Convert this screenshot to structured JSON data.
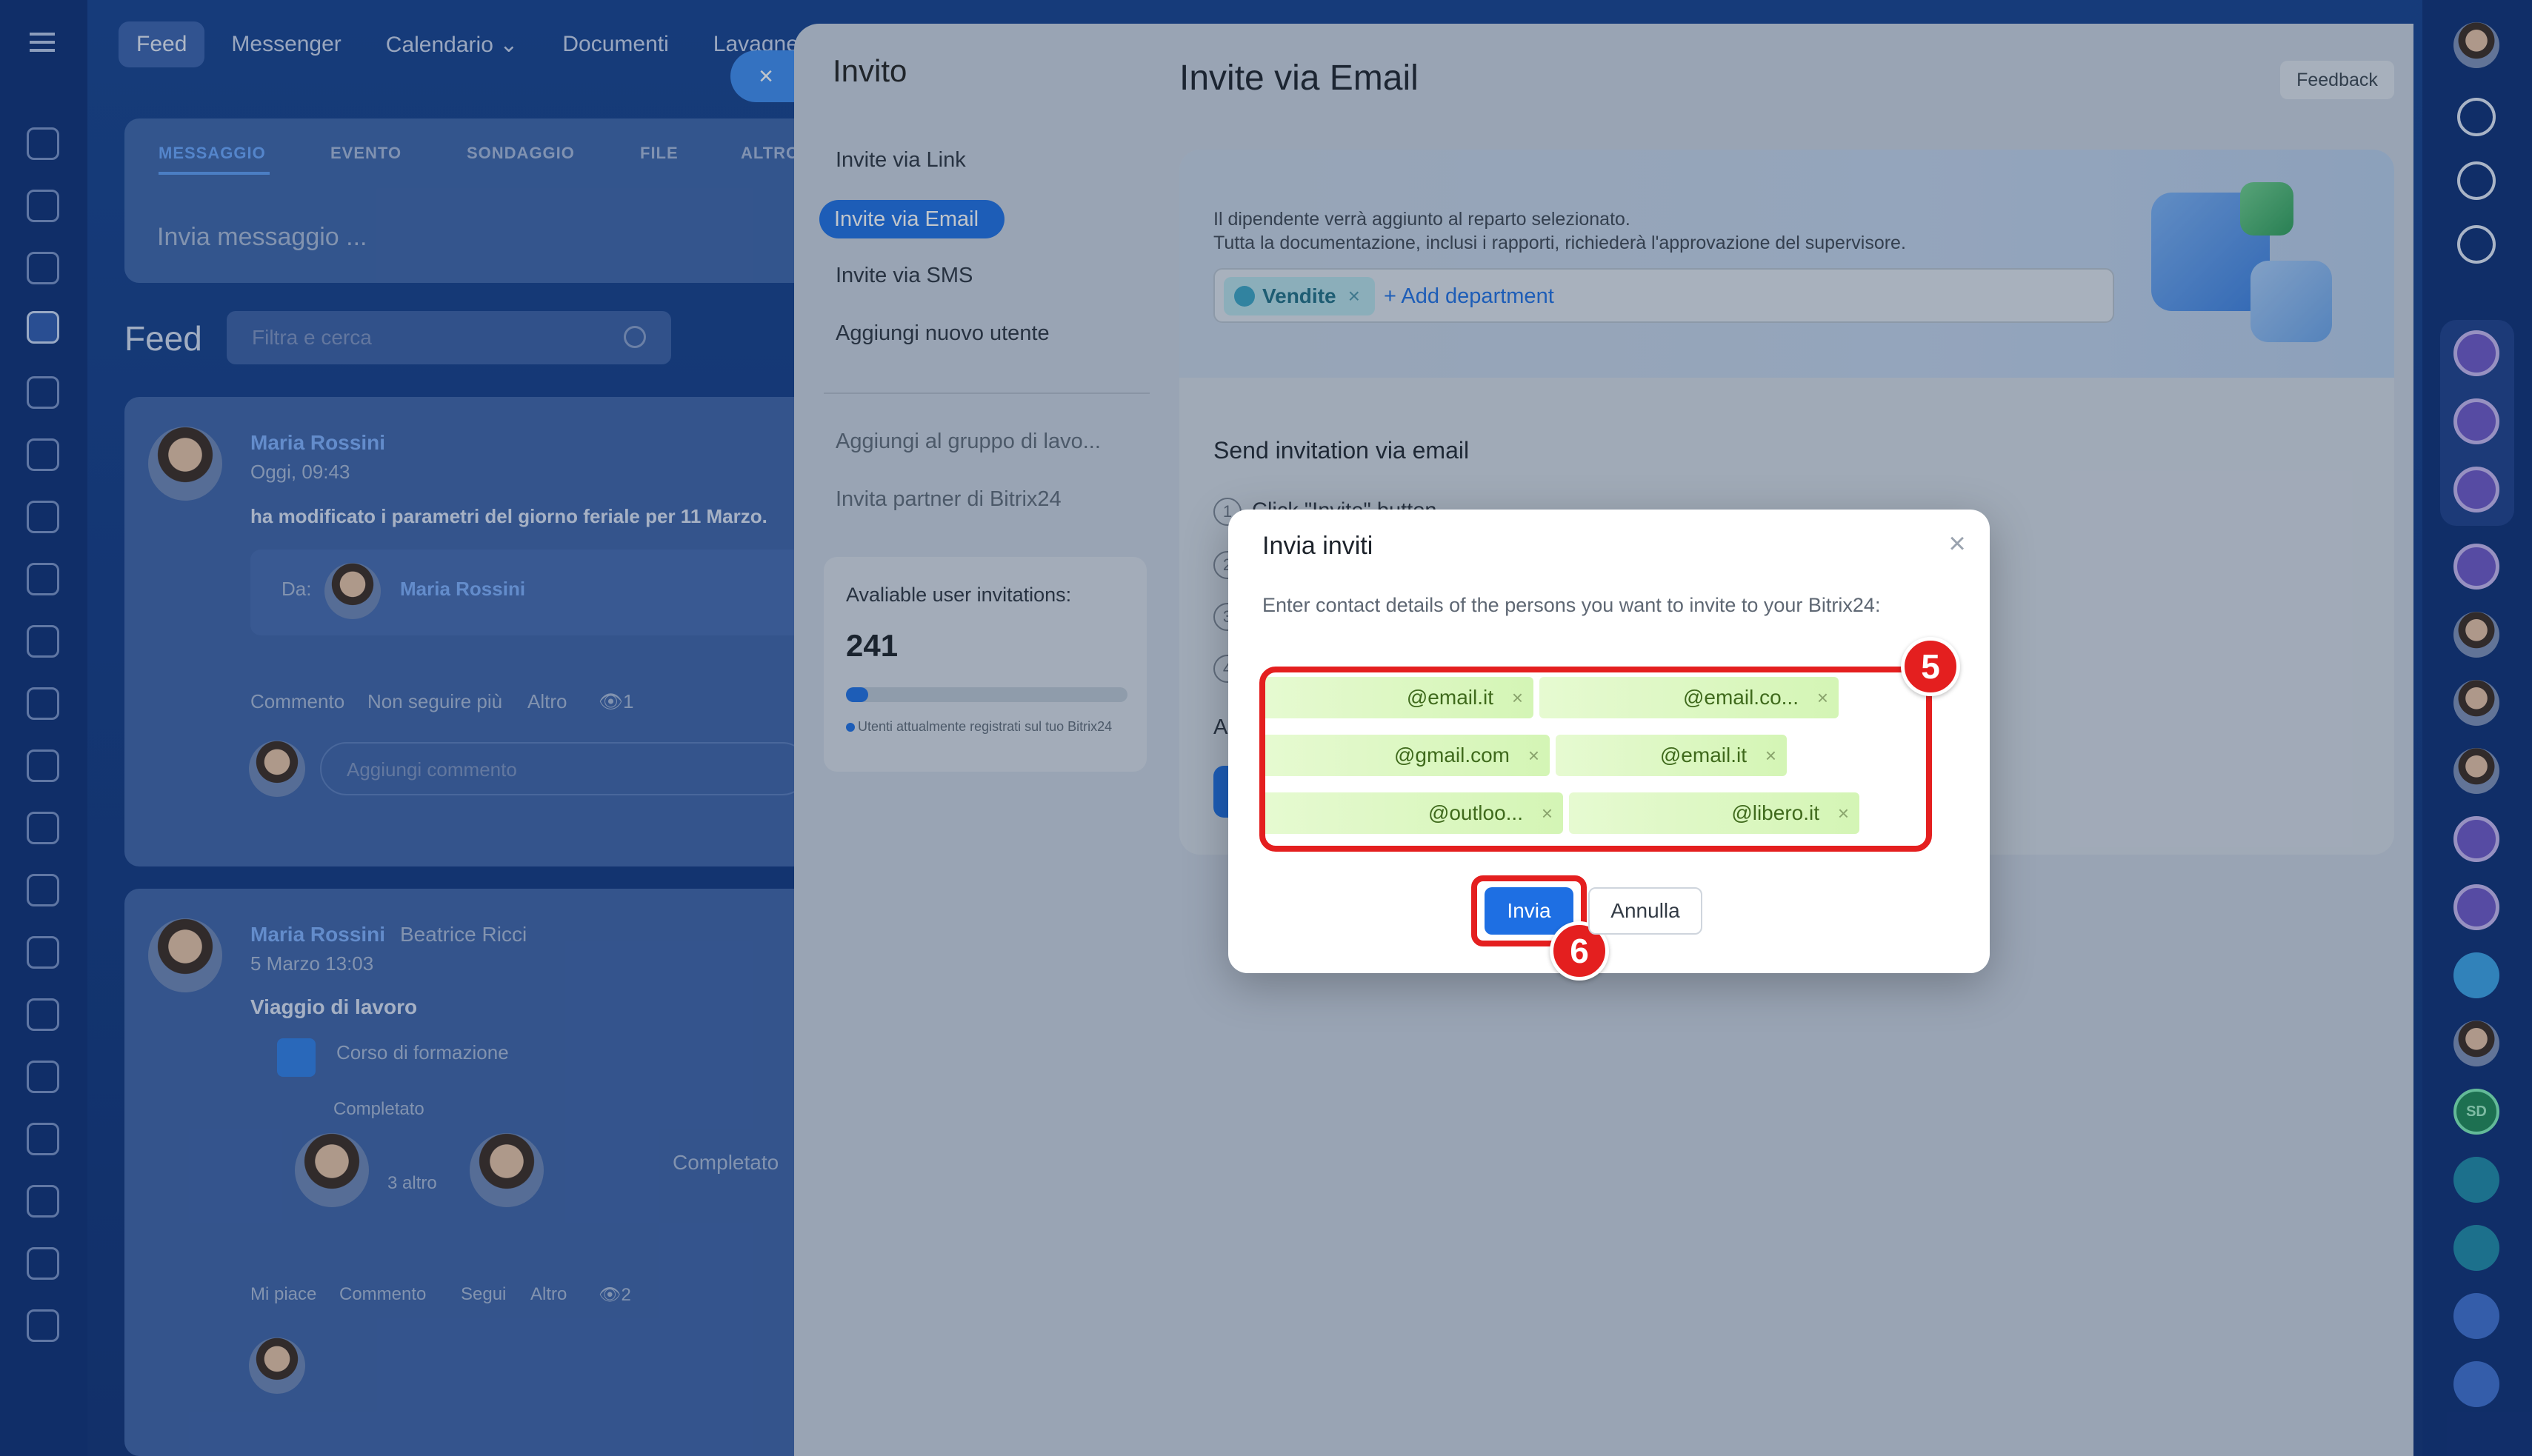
{
  "background": {
    "top_nav": [
      "Feed",
      "Messenger",
      "Calendario ⌄",
      "Documenti",
      "Lavagne"
    ],
    "composer": {
      "tabs": [
        "MESSAGGIO",
        "EVENTO",
        "SONDAGGIO",
        "FILE",
        "ALTRO"
      ],
      "placeholder": "Invia messaggio ..."
    },
    "feed_title": "Feed",
    "filter_placeholder": "Filtra e cerca",
    "post1": {
      "author": "Maria Rossini",
      "time": "Oggi, 09:43",
      "text": "ha modificato i parametri del giorno feriale per 11 Marzo.",
      "from_label": "Da:",
      "from_name": "Maria Rossini",
      "actions": [
        "Commento",
        "Non seguire più",
        "Altro",
        "👁1"
      ],
      "comment_placeholder": "Aggiungi commento"
    },
    "post2": {
      "author": "Maria Rossini",
      "recipient": "Beatrice Ricci",
      "time": "5 Marzo 13:03",
      "title": "Viaggio di lavoro",
      "course": "Corso di formazione",
      "status": "Completato",
      "more": "3 altro",
      "status2": "Completato",
      "actions": [
        "Mi piace",
        "Commento",
        "Segui",
        "Altro",
        "👁2"
      ]
    }
  },
  "invite_nav": {
    "title": "Invito",
    "items": [
      "Invite via Link",
      "Invite via Email",
      "Invite via SMS",
      "Aggiungi nuovo utente"
    ],
    "secondary_items": [
      "Aggiungi al gruppo di lavo...",
      "Invita partner di Bitrix24"
    ],
    "available": {
      "label": "Avaliable user invitations:",
      "count": "241",
      "progress": 0.04,
      "note": "Utenti attualmente registrati sul tuo Bitrix24"
    }
  },
  "content": {
    "title": "Invite via Email",
    "feedback": "Feedback",
    "dept_line1": "Il dipendente verrà aggiunto al reparto selezionato.",
    "dept_line2": "Tutta la documentazione, inclusi i rapporti, richiederà l'approvazione del supervisore.",
    "dept_tag": "Vendite",
    "add_department": "+ Add department",
    "send_heading": "Send invitation via email",
    "steps": [
      {
        "num": "1",
        "text": "Click \"Invite\" button."
      },
      {
        "num": "2",
        "text": ""
      },
      {
        "num": "3",
        "text": ""
      },
      {
        "num": "4",
        "text": ""
      }
    ],
    "a_stub": "A"
  },
  "modal": {
    "title": "Invia inviti",
    "description": "Enter contact details of the persons you want to invite to your Bitrix24:",
    "emails": [
      "@email.it",
      "@email.co...",
      "@gmail.com",
      "@email.it",
      "@outloo...",
      "@libero.it"
    ],
    "send_label": "Invia",
    "cancel_label": "Annulla",
    "badge_emails": "5",
    "badge_send": "6"
  },
  "colors": {
    "accent": "#1e6fe3",
    "annotation": "#e41f1f",
    "email_tag": "#d4f5b5"
  },
  "icons": {
    "close": "×",
    "remove": "×"
  }
}
